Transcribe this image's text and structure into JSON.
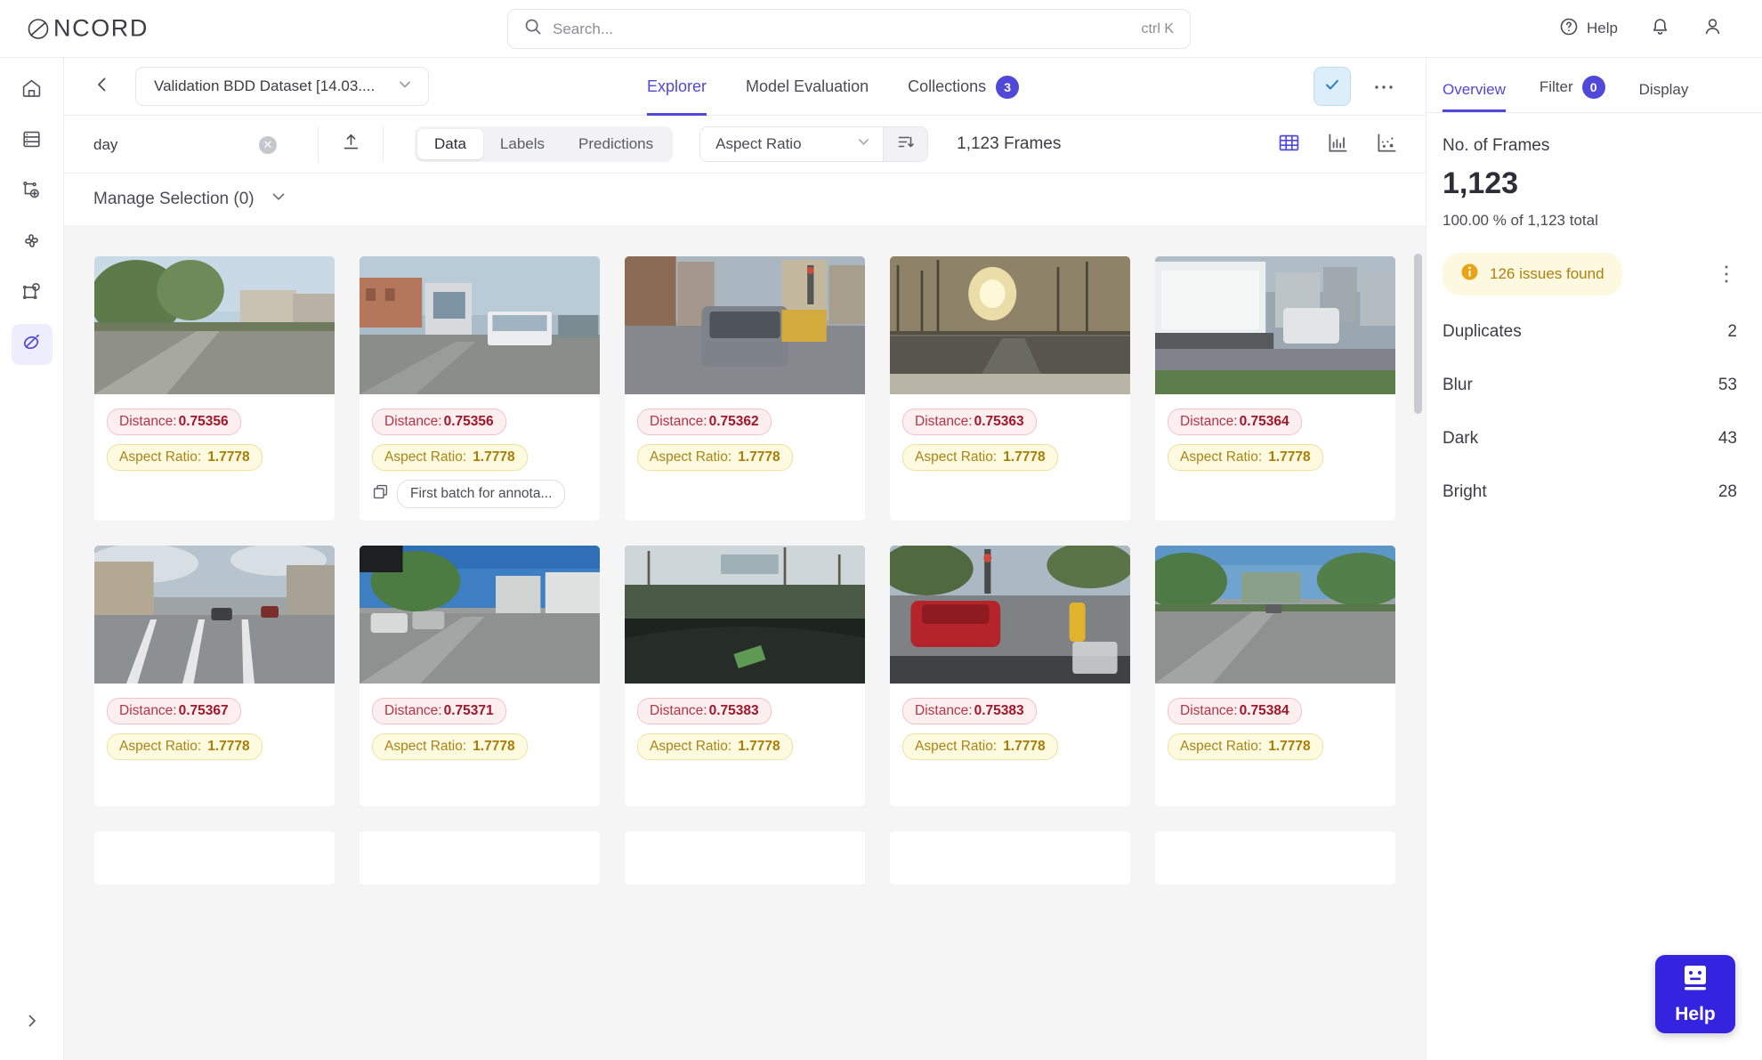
{
  "app": {
    "brand": "NCORD",
    "brand_icon": "encord-logo-icon"
  },
  "topbar": {
    "search_placeholder": "Search...",
    "search_value": "",
    "shortcut_hint": "ctrl K",
    "help_label": "Help",
    "notifications_icon": "bell-icon",
    "account_icon": "user-avatar-icon"
  },
  "rail": {
    "items": [
      {
        "name": "home",
        "icon": "home-icon",
        "active": false
      },
      {
        "name": "datasets",
        "icon": "database-icon",
        "active": false
      },
      {
        "name": "annotate",
        "icon": "annotate-add-icon",
        "active": false
      },
      {
        "name": "workflows",
        "icon": "workflow-icon",
        "active": false
      },
      {
        "name": "models",
        "icon": "model-shapes-icon",
        "active": false
      },
      {
        "name": "active-explorer",
        "icon": "encord-active-icon",
        "active": true
      }
    ],
    "expand_icon": "chevron-right-icon"
  },
  "subheader": {
    "back_icon": "chevron-left-icon",
    "dataset_name": "Validation BDD Dataset [14.03....",
    "dataset_chevron_icon": "chevron-down-icon",
    "tabs": [
      {
        "label": "Explorer",
        "badge": null,
        "active": true
      },
      {
        "label": "Model Evaluation",
        "badge": null,
        "active": false
      },
      {
        "label": "Collections",
        "badge": "3",
        "active": false
      }
    ],
    "check_icon": "check-icon",
    "more_icon": "ellipsis-horizontal-icon"
  },
  "toolbar": {
    "filter_value": "day",
    "filter_placeholder": "Search...",
    "clear_icon": "clear-circle-icon",
    "upload_icon": "upload-icon",
    "segments": [
      {
        "label": "Data",
        "active": true
      },
      {
        "label": "Labels",
        "active": false
      },
      {
        "label": "Predictions",
        "active": false
      }
    ],
    "sort_value": "Aspect Ratio",
    "sort_chevron_icon": "chevron-down-icon",
    "sort_direction_icon": "sort-descending-icon",
    "frame_count": "1,123 Frames",
    "views": [
      {
        "name": "grid-view",
        "icon": "grid-icon",
        "active": true
      },
      {
        "name": "bar-chart-view",
        "icon": "bar-chart-icon",
        "active": false
      },
      {
        "name": "scatter-plot-view",
        "icon": "scatter-plot-icon",
        "active": false
      }
    ]
  },
  "manage": {
    "label": "Manage Selection (0)",
    "chevron_icon": "chevron-down-icon"
  },
  "grid": {
    "cards": [
      {
        "distance_label": "Distance:",
        "distance_value": "0.75356",
        "ratio_label": "Aspect Ratio:",
        "ratio_value": "1.7778",
        "collection": null,
        "scene": "suburb-road"
      },
      {
        "distance_label": "Distance:",
        "distance_value": "0.75356",
        "ratio_label": "Aspect Ratio:",
        "ratio_value": "1.7778",
        "collection": "First batch for annota...",
        "scene": "bus-street"
      },
      {
        "distance_label": "Distance:",
        "distance_value": "0.75362",
        "ratio_label": "Aspect Ratio:",
        "ratio_value": "1.7778",
        "collection": null,
        "scene": "city-suv"
      },
      {
        "distance_label": "Distance:",
        "distance_value": "0.75363",
        "ratio_label": "Aspect Ratio:",
        "ratio_value": "1.7778",
        "collection": null,
        "scene": "sunset-road"
      },
      {
        "distance_label": "Distance:",
        "distance_value": "0.75364",
        "ratio_label": "Aspect Ratio:",
        "ratio_value": "1.7778",
        "collection": null,
        "scene": "truck-rear"
      },
      {
        "distance_label": "Distance:",
        "distance_value": "0.75367",
        "ratio_label": "Aspect Ratio:",
        "ratio_value": "1.7778",
        "collection": null,
        "scene": "wide-street"
      },
      {
        "distance_label": "Distance:",
        "distance_value": "0.75371",
        "ratio_label": "Aspect Ratio:",
        "ratio_value": "1.7778",
        "collection": null,
        "scene": "palm-street"
      },
      {
        "distance_label": "Distance:",
        "distance_value": "0.75383",
        "ratio_label": "Aspect Ratio:",
        "ratio_value": "1.7778",
        "collection": null,
        "scene": "dark-hedge"
      },
      {
        "distance_label": "Distance:",
        "distance_value": "0.75383",
        "ratio_label": "Aspect Ratio:",
        "ratio_value": "1.7778",
        "collection": null,
        "scene": "red-car"
      },
      {
        "distance_label": "Distance:",
        "distance_value": "0.75384",
        "ratio_label": "Aspect Ratio:",
        "ratio_value": "1.7778",
        "collection": null,
        "scene": "tree-road"
      },
      {
        "distance_label": "",
        "distance_value": "",
        "ratio_label": "",
        "ratio_value": "",
        "collection": null,
        "scene": "blank"
      },
      {
        "distance_label": "",
        "distance_value": "",
        "ratio_label": "",
        "ratio_value": "",
        "collection": null,
        "scene": "blank"
      },
      {
        "distance_label": "",
        "distance_value": "",
        "ratio_label": "",
        "ratio_value": "",
        "collection": null,
        "scene": "blank"
      },
      {
        "distance_label": "",
        "distance_value": "",
        "ratio_label": "",
        "ratio_value": "",
        "collection": null,
        "scene": "blank"
      },
      {
        "distance_label": "",
        "distance_value": "",
        "ratio_label": "",
        "ratio_value": "",
        "collection": null,
        "scene": "blank"
      }
    ]
  },
  "panel": {
    "tabs": [
      {
        "label": "Overview",
        "badge": null,
        "active": true
      },
      {
        "label": "Filter",
        "badge": "0",
        "active": false
      },
      {
        "label": "Display",
        "badge": null,
        "active": false
      }
    ],
    "frames_label": "No. of Frames",
    "frames_value": "1,123",
    "frames_sub": "100.00 % of 1,123 total",
    "issues_text": "126 issues found",
    "issues_icon": "info-circle-icon",
    "issues_more_icon": "ellipsis-vertical-icon",
    "stats": [
      {
        "label": "Duplicates",
        "value": "2"
      },
      {
        "label": "Blur",
        "value": "53"
      },
      {
        "label": "Dark",
        "value": "43"
      },
      {
        "label": "Bright",
        "value": "28"
      }
    ]
  },
  "help_widget": {
    "label": "Help",
    "icon": "robot-face-icon"
  },
  "colors": {
    "accent": "#5048d8",
    "help_widget": "#3424e0",
    "distance_badge_bg": "#fdeff0",
    "distance_badge_text": "#a21629",
    "ratio_badge_bg": "#fdfadf",
    "ratio_badge_text": "#a87d08",
    "issues_bg": "#fdf8e0",
    "issues_text": "#b07f0d"
  }
}
